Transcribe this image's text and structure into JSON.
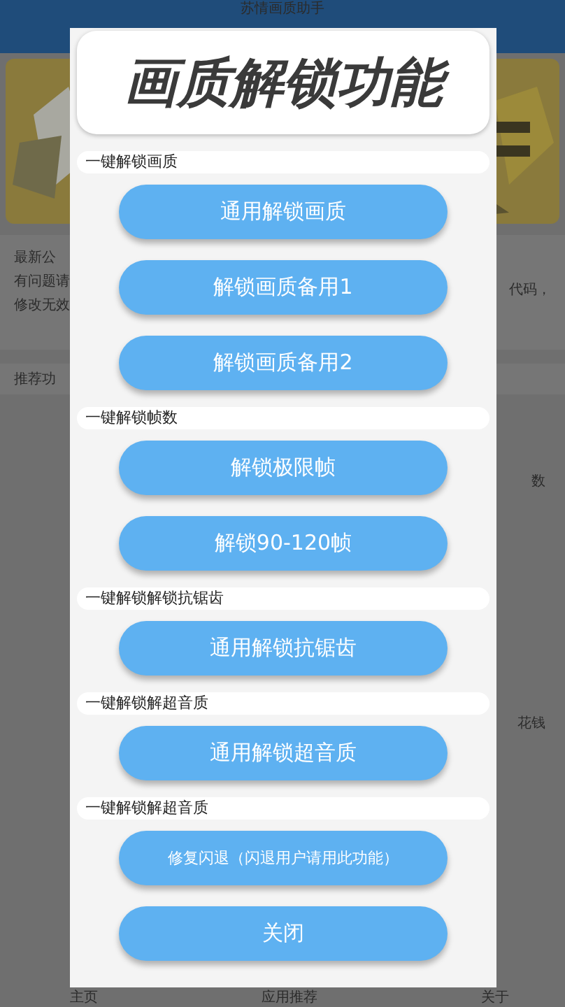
{
  "app_bar": {
    "title": "苏情画质助手"
  },
  "background": {
    "notice_title": "最新公",
    "notice_lines": [
      "有问题请",
      "修改无效"
    ],
    "notice_right": "代码，",
    "recommend_title": "推荐功",
    "grid_fragments": [
      "数",
      "花钱"
    ]
  },
  "bottom_nav": [
    "主页",
    "应用推荐",
    "关于"
  ],
  "dialog": {
    "title": "画质解锁功能",
    "sections": [
      {
        "label": "一键解锁画质",
        "buttons": [
          "通用解锁画质",
          "解锁画质备用1",
          "解锁画质备用2"
        ]
      },
      {
        "label": "一键解锁帧数",
        "buttons": [
          "解锁极限帧",
          "解锁90-120帧"
        ]
      },
      {
        "label": "一键解锁解锁抗锯齿",
        "buttons": [
          "通用解锁抗锯齿"
        ]
      },
      {
        "label": "一键解锁解超音质",
        "buttons": [
          "通用解锁超音质"
        ]
      },
      {
        "label": "一键解锁解超音质",
        "buttons": [
          "修复闪退（闪退用户请用此功能）"
        ]
      }
    ],
    "close_button": "关闭"
  }
}
